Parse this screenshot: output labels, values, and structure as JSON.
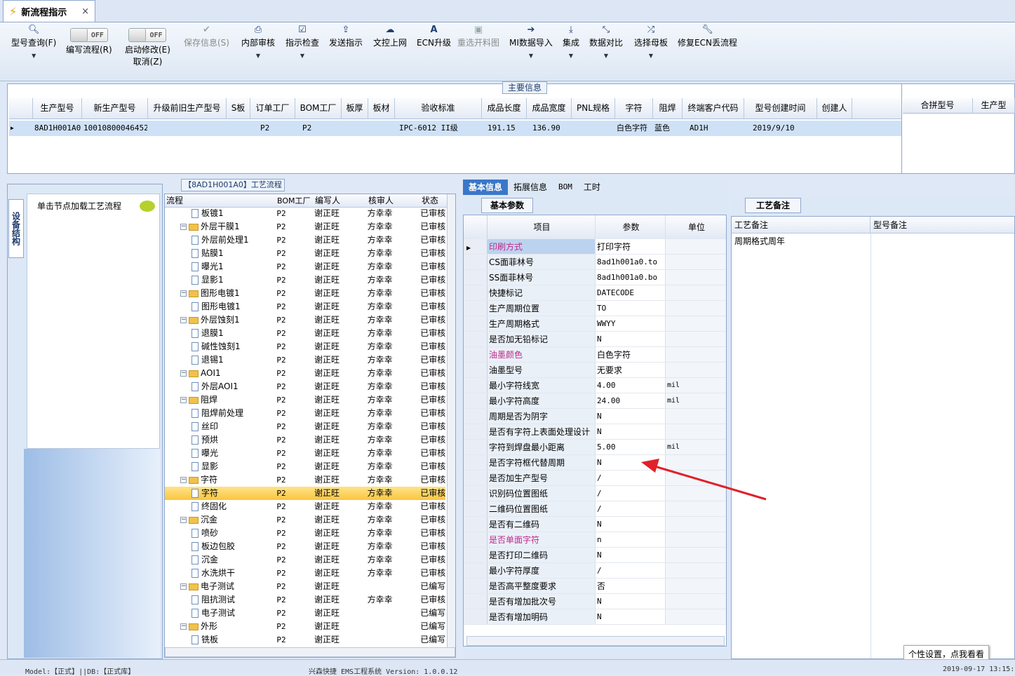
{
  "window": {
    "tab_title": "新流程指示",
    "close_glyph": "×"
  },
  "toolbar": {
    "model_query": "型号查询(F)",
    "toggle1_state": "OFF",
    "edit_flow": "编写流程(R)",
    "toggle2_state": "OFF",
    "start_modify": "启动修改(E)",
    "cancel": "取消(Z)",
    "save_info": "保存信息(S)",
    "internal_review": "内部审核",
    "instruction_check": "指示检查",
    "send_instruction": "发送指示",
    "doc_upload": "文控上网",
    "ecn_upgrade": "ECN升级",
    "reselect_cutting": "重选开料图",
    "mi_import": "MI数据导入",
    "integrate": "集成",
    "data_compare": "数据对比",
    "select_master": "选择母板",
    "repair_ecn": "修复ECN丢流程"
  },
  "main_info": {
    "title": "主要信息",
    "columns": [
      "生产型号",
      "新生产型号",
      "升级前旧生产型号",
      "S板",
      "订单工厂",
      "BOM工厂",
      "板厚",
      "板材",
      "验收标准",
      "成品长度",
      "成品宽度",
      "PNL规格",
      "字符",
      "阻焊",
      "终端客户代码",
      "型号创建时间",
      "创建人"
    ],
    "row": [
      "8AD1H001A0",
      "10010800046452",
      "",
      "",
      "P2",
      "P2",
      "",
      "",
      "IPC-6012 II级",
      "191.15",
      "136.90",
      "",
      "白色字符",
      "蓝色",
      "AD1H",
      "2019/9/10",
      ""
    ],
    "right_columns": [
      "合拼型号",
      "生产型"
    ]
  },
  "left_panel": {
    "side_tab": "设备结构",
    "load_hint": "单击节点加载工艺流程"
  },
  "tree": {
    "title": "【8AD1H001A0】工艺流程",
    "columns": [
      "流程",
      "BOM工厂",
      "编写人",
      "核审人",
      "状态"
    ],
    "rows": [
      {
        "lvl": 2,
        "type": "file",
        "name": "板镀1",
        "bom": "P2",
        "writer": "谢正旺",
        "reviewer": "方幸幸",
        "status": "已审核"
      },
      {
        "lvl": 1,
        "type": "folder",
        "name": "外层干膜1",
        "bom": "P2",
        "writer": "谢正旺",
        "reviewer": "方幸幸",
        "status": "已审核"
      },
      {
        "lvl": 2,
        "type": "file",
        "name": "外层前处理1",
        "bom": "P2",
        "writer": "谢正旺",
        "reviewer": "方幸幸",
        "status": "已审核"
      },
      {
        "lvl": 2,
        "type": "file",
        "name": "贴膜1",
        "bom": "P2",
        "writer": "谢正旺",
        "reviewer": "方幸幸",
        "status": "已审核"
      },
      {
        "lvl": 2,
        "type": "file",
        "name": "曝光1",
        "bom": "P2",
        "writer": "谢正旺",
        "reviewer": "方幸幸",
        "status": "已审核"
      },
      {
        "lvl": 2,
        "type": "file",
        "name": "显影1",
        "bom": "P2",
        "writer": "谢正旺",
        "reviewer": "方幸幸",
        "status": "已审核"
      },
      {
        "lvl": 1,
        "type": "folder",
        "name": "图形电镀1",
        "bom": "P2",
        "writer": "谢正旺",
        "reviewer": "方幸幸",
        "status": "已审核"
      },
      {
        "lvl": 2,
        "type": "file",
        "name": "图形电镀1",
        "bom": "P2",
        "writer": "谢正旺",
        "reviewer": "方幸幸",
        "status": "已审核"
      },
      {
        "lvl": 1,
        "type": "folder",
        "name": "外层蚀刻1",
        "bom": "P2",
        "writer": "谢正旺",
        "reviewer": "方幸幸",
        "status": "已审核"
      },
      {
        "lvl": 2,
        "type": "file",
        "name": "退膜1",
        "bom": "P2",
        "writer": "谢正旺",
        "reviewer": "方幸幸",
        "status": "已审核"
      },
      {
        "lvl": 2,
        "type": "file",
        "name": "碱性蚀刻1",
        "bom": "P2",
        "writer": "谢正旺",
        "reviewer": "方幸幸",
        "status": "已审核"
      },
      {
        "lvl": 2,
        "type": "file",
        "name": "退锡1",
        "bom": "P2",
        "writer": "谢正旺",
        "reviewer": "方幸幸",
        "status": "已审核"
      },
      {
        "lvl": 1,
        "type": "folder",
        "name": "AOI1",
        "bom": "P2",
        "writer": "谢正旺",
        "reviewer": "方幸幸",
        "status": "已审核"
      },
      {
        "lvl": 2,
        "type": "file",
        "name": "外层AOI1",
        "bom": "P2",
        "writer": "谢正旺",
        "reviewer": "方幸幸",
        "status": "已审核"
      },
      {
        "lvl": 1,
        "type": "folder",
        "name": "阻焊",
        "bom": "P2",
        "writer": "谢正旺",
        "reviewer": "方幸幸",
        "status": "已审核"
      },
      {
        "lvl": 2,
        "type": "file",
        "name": "阻焊前处理",
        "bom": "P2",
        "writer": "谢正旺",
        "reviewer": "方幸幸",
        "status": "已审核"
      },
      {
        "lvl": 2,
        "type": "file",
        "name": "丝印",
        "bom": "P2",
        "writer": "谢正旺",
        "reviewer": "方幸幸",
        "status": "已审核"
      },
      {
        "lvl": 2,
        "type": "file",
        "name": "预烘",
        "bom": "P2",
        "writer": "谢正旺",
        "reviewer": "方幸幸",
        "status": "已审核"
      },
      {
        "lvl": 2,
        "type": "file",
        "name": "曝光",
        "bom": "P2",
        "writer": "谢正旺",
        "reviewer": "方幸幸",
        "status": "已审核"
      },
      {
        "lvl": 2,
        "type": "file",
        "name": "显影",
        "bom": "P2",
        "writer": "谢正旺",
        "reviewer": "方幸幸",
        "status": "已审核"
      },
      {
        "lvl": 1,
        "type": "folder",
        "name": "字符",
        "bom": "P2",
        "writer": "谢正旺",
        "reviewer": "方幸幸",
        "status": "已审核"
      },
      {
        "lvl": 2,
        "type": "file",
        "name": "字符",
        "bom": "P2",
        "writer": "谢正旺",
        "reviewer": "方幸幸",
        "status": "已审核",
        "selected": true
      },
      {
        "lvl": 2,
        "type": "file",
        "name": "终固化",
        "bom": "P2",
        "writer": "谢正旺",
        "reviewer": "方幸幸",
        "status": "已审核"
      },
      {
        "lvl": 1,
        "type": "folder",
        "name": "沉金",
        "bom": "P2",
        "writer": "谢正旺",
        "reviewer": "方幸幸",
        "status": "已审核"
      },
      {
        "lvl": 2,
        "type": "file",
        "name": "喷砂",
        "bom": "P2",
        "writer": "谢正旺",
        "reviewer": "方幸幸",
        "status": "已审核"
      },
      {
        "lvl": 2,
        "type": "file",
        "name": "板边包胶",
        "bom": "P2",
        "writer": "谢正旺",
        "reviewer": "方幸幸",
        "status": "已审核"
      },
      {
        "lvl": 2,
        "type": "file",
        "name": "沉金",
        "bom": "P2",
        "writer": "谢正旺",
        "reviewer": "方幸幸",
        "status": "已审核"
      },
      {
        "lvl": 2,
        "type": "file",
        "name": "水洗烘干",
        "bom": "P2",
        "writer": "谢正旺",
        "reviewer": "方幸幸",
        "status": "已审核"
      },
      {
        "lvl": 1,
        "type": "folder",
        "name": "电子测试",
        "bom": "P2",
        "writer": "谢正旺",
        "reviewer": "",
        "status": "已编写"
      },
      {
        "lvl": 2,
        "type": "file",
        "name": "阻抗测试",
        "bom": "P2",
        "writer": "谢正旺",
        "reviewer": "方幸幸",
        "status": "已审核"
      },
      {
        "lvl": 2,
        "type": "file",
        "name": "电子测试",
        "bom": "P2",
        "writer": "谢正旺",
        "reviewer": "",
        "status": "已编写"
      },
      {
        "lvl": 1,
        "type": "folder",
        "name": "外形",
        "bom": "P2",
        "writer": "谢正旺",
        "reviewer": "",
        "status": "已编写"
      },
      {
        "lvl": 2,
        "type": "file",
        "name": "铣板",
        "bom": "P2",
        "writer": "谢正旺",
        "reviewer": "",
        "status": "已编写"
      }
    ]
  },
  "detail_tabs": [
    "基本信息",
    "拓展信息",
    "BOM",
    "工时"
  ],
  "params": {
    "title": "基本参数",
    "columns": [
      "项目",
      "参数",
      "单位"
    ],
    "rows": [
      {
        "item": "印刷方式",
        "value": "打印字符",
        "unit": "",
        "pink": true,
        "current": true
      },
      {
        "item": "CS面菲林号",
        "value": "8ad1h001a0.to",
        "unit": ""
      },
      {
        "item": "SS面菲林号",
        "value": "8ad1h001a0.bo",
        "unit": ""
      },
      {
        "item": "快捷标记",
        "value": "DATECODE",
        "unit": ""
      },
      {
        "item": "生产周期位置",
        "value": "TO",
        "unit": ""
      },
      {
        "item": "生产周期格式",
        "value": "WWYY",
        "unit": ""
      },
      {
        "item": "是否加无铅标记",
        "value": "N",
        "unit": ""
      },
      {
        "item": "油墨颜色",
        "value": "白色字符",
        "unit": "",
        "pink": true
      },
      {
        "item": "油墨型号",
        "value": "无要求",
        "unit": ""
      },
      {
        "item": "最小字符线宽",
        "value": "4.00",
        "unit": "mil"
      },
      {
        "item": "最小字符高度",
        "value": "24.00",
        "unit": "mil"
      },
      {
        "item": "周期是否为阴字",
        "value": "N",
        "unit": ""
      },
      {
        "item": "是否有字符上表面处理设计",
        "value": "N",
        "unit": ""
      },
      {
        "item": "字符到焊盘最小距离",
        "value": "5.00",
        "unit": "mil"
      },
      {
        "item": "是否字符框代替周期",
        "value": "N",
        "unit": ""
      },
      {
        "item": "是否加生产型号",
        "value": "/",
        "unit": ""
      },
      {
        "item": "识别码位置图纸",
        "value": "/",
        "unit": ""
      },
      {
        "item": "二维码位置图纸",
        "value": "/",
        "unit": ""
      },
      {
        "item": "是否有二维码",
        "value": "N",
        "unit": ""
      },
      {
        "item": "是否单面字符",
        "value": "n",
        "unit": "",
        "pink": true
      },
      {
        "item": "是否打印二维码",
        "value": "N",
        "unit": ""
      },
      {
        "item": "最小字符厚度",
        "value": "/",
        "unit": ""
      },
      {
        "item": "是否高平整度要求",
        "value": "否",
        "unit": ""
      },
      {
        "item": "是否有增加批次号",
        "value": "N",
        "unit": ""
      },
      {
        "item": "是否有增加明码",
        "value": "N",
        "unit": ""
      }
    ]
  },
  "craft": {
    "title": "工艺备注",
    "columns": [
      "工艺备注",
      "型号备注"
    ],
    "note": "周期格式周年"
  },
  "status_bar": {
    "left": "Model:【正式】||DB:【正式库】",
    "center": "兴森快捷 EMS工程系统 Version: 1.0.0.12",
    "right": "2019-09-17 13:15:"
  },
  "tooltip": "个性设置，点我看看",
  "colors": {
    "accent": "#3a77c8",
    "selected_row": "#cfe1f6",
    "tree_selected": "#f9c63f",
    "arrow": "#e0202a",
    "pink_label": "#c0288a"
  }
}
